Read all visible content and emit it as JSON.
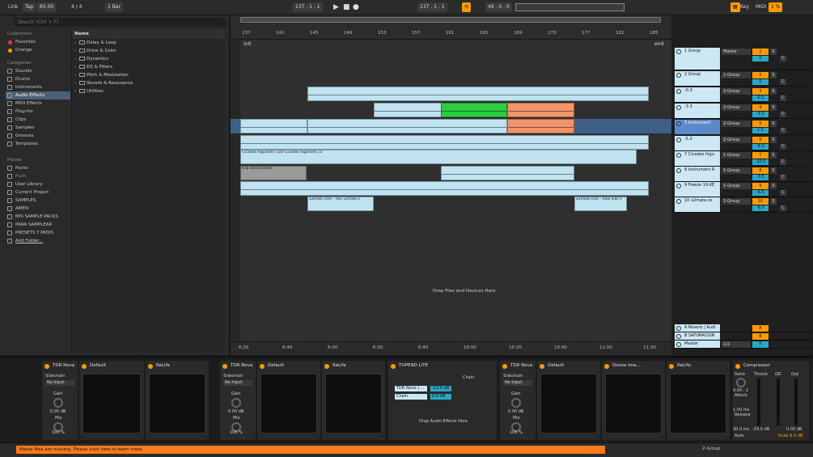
{
  "transport": {
    "link": "Link",
    "tap": "Tap",
    "tempo": "65.00",
    "time_sig": "4 / 4",
    "quant": "1 Bar",
    "position": "137 .  1 .  1",
    "position2": "137 .  1 .  1",
    "length": "49 .  0 .  0",
    "key": "Key",
    "midi": "MIDI",
    "cpu": "1 %"
  },
  "browser": {
    "search_placeholder": "Search (Ctrl + F)",
    "collections_title": "Collections",
    "collections": [
      {
        "label": "Favorites",
        "color": "#e23b3b"
      },
      {
        "label": "Orange",
        "color": "#ff9a00"
      }
    ],
    "categories_title": "Categories",
    "categories": [
      "Sounds",
      "Drums",
      "Instruments",
      "Audio Effects",
      "MIDI Effects",
      "Plug-Ins",
      "Clips",
      "Samples",
      "Grooves",
      "Templates"
    ],
    "selected_category": "Audio Effects",
    "places_title": "Places",
    "places": [
      "Packs",
      "Push",
      "User Library",
      "Current Project",
      "SAMPLES",
      "AMEN",
      "MIS SAMPLE PACKS",
      "PARA SAMPLEAR",
      "PRESETS Y MIDIS",
      "Add Folder..."
    ],
    "name_header": "Name",
    "folders": [
      "Delay & Loop",
      "Drive & Color",
      "Dynamics",
      "EQ & Filters",
      "Pitch & Modulation",
      "Reverb & Resonance",
      "Utilities"
    ]
  },
  "arrangement": {
    "bar_labels": [
      "137",
      "141",
      "145",
      "149",
      "153",
      "157",
      "161",
      "165",
      "169",
      "173",
      "177",
      "181",
      "185"
    ],
    "locator_start": "init",
    "locator_end": "end",
    "time_labels": [
      "6:20",
      "6:40",
      "6:00",
      "6:20",
      "6:40",
      "10:00",
      "10:20",
      "10:40",
      "11:00",
      "11:30"
    ],
    "drop_label": "Drop Files and Devices Here",
    "clip_labels": {
      "cicadas": "Cicadas higurashi (320",
      "cicadas2": "Cicadas higurashi (3",
      "deactivated": "Clip Deactivated",
      "x2mate": "x2mate.com - Riki x2mate.c",
      "x2mate2": "x2mate.com - Riko kills h"
    }
  },
  "mixer": {
    "tracks": [
      {
        "name": "1 Group",
        "route": "Master",
        "num": "1",
        "vol": "0"
      },
      {
        "name": "2 Group",
        "route": "1-Group",
        "num": "2",
        "vol": "0"
      },
      {
        "name": "-0.3",
        "route": "2-Group",
        "num": "3",
        "vol": "-0.5"
      },
      {
        "name": "-3.3",
        "route": "2-Group",
        "num": "4",
        "vol": "-3.5"
      },
      {
        "name": "5 Instrument",
        "route": "2-Group",
        "num": "5",
        "vol": "1.0"
      },
      {
        "name": "-5.2",
        "route": "2-Group",
        "num": "6",
        "vol": "-6.0"
      },
      {
        "name": "7 Cicadas higu",
        "route": "1-Group",
        "num": "7",
        "vol": "-10.5"
      },
      {
        "name": "8 Instrument R",
        "route": "1-Group",
        "num": "8",
        "vol": "-3.5"
      },
      {
        "name": "9 Freeze 10-VE",
        "route": "1-Group",
        "num": "9",
        "vol": "-6.5"
      },
      {
        "name": "10 x2mate.co",
        "route": "1-Group",
        "num": "10",
        "vol": "-6.5"
      }
    ],
    "returns": [
      {
        "name": "A Reverb | Audi",
        "num": "A"
      },
      {
        "name": "B SATURACION",
        "num": "B"
      },
      {
        "name": "Master",
        "route": "1/2",
        "num": "0"
      }
    ]
  },
  "devices": [
    {
      "title": "TDR Nova",
      "sidechain": "Sidechain",
      "input": "No Input",
      "gain_label": "Gain",
      "gain_val": "0.00 dB",
      "mix_label": "Mix",
      "mix_val": "100 %",
      "mute": "Mute"
    },
    {
      "title": "Default"
    },
    {
      "title": "ReLife"
    },
    {
      "title": "TDR Nova",
      "sidechain": "Sidechain",
      "input": "No Input",
      "gain_label": "Gain",
      "gain_val": "0.00 dB",
      "mix_label": "Mix",
      "mix_val": "100 %",
      "mute": "Mute"
    },
    {
      "title": "Default"
    },
    {
      "title": "ReLife"
    },
    {
      "title": "TOPEND LITE",
      "chain": "Chain",
      "chain_item": "TDR Nova | ...",
      "chain_vol": "-13.0 dB",
      "chain2": "Chain",
      "chain2_vol": "0.0 dB",
      "drop": "Drop Audio Effects Here"
    },
    {
      "title": "TDR Nova",
      "sidechain": "Sidechain",
      "input": "No Input",
      "gain_label": "Gain",
      "gain_val": "0.00 dB",
      "mix_label": "Mix",
      "mix_val": "100 %",
      "mute": "Mute"
    },
    {
      "title": "Default"
    },
    {
      "title": "Ozone Ima..."
    },
    {
      "title": "ReLife"
    },
    {
      "title": "Compressor",
      "ratio": "Ratio",
      "ratio_val": "4.00 : 1",
      "attack": "Attack",
      "attack_val": "1.00 ms",
      "release": "Release",
      "release_val": "30.0 ms",
      "auto": "Auto",
      "thresh": "Thresh",
      "gr": "GR",
      "out": "Out",
      "thresh_val": "-29.0 dB",
      "out_val": "0.00 dB",
      "knee": "Knee 6.0 dB"
    }
  ],
  "status": {
    "message": "Media files are missing. Please click here to learn more.",
    "track": "2-Group"
  },
  "colors": {
    "accent": "#ff9a00",
    "clip_blue": "#bfe3f1",
    "clip_green": "#2ecc40",
    "clip_orange": "#f2946a",
    "selected": "#4b5f75"
  }
}
